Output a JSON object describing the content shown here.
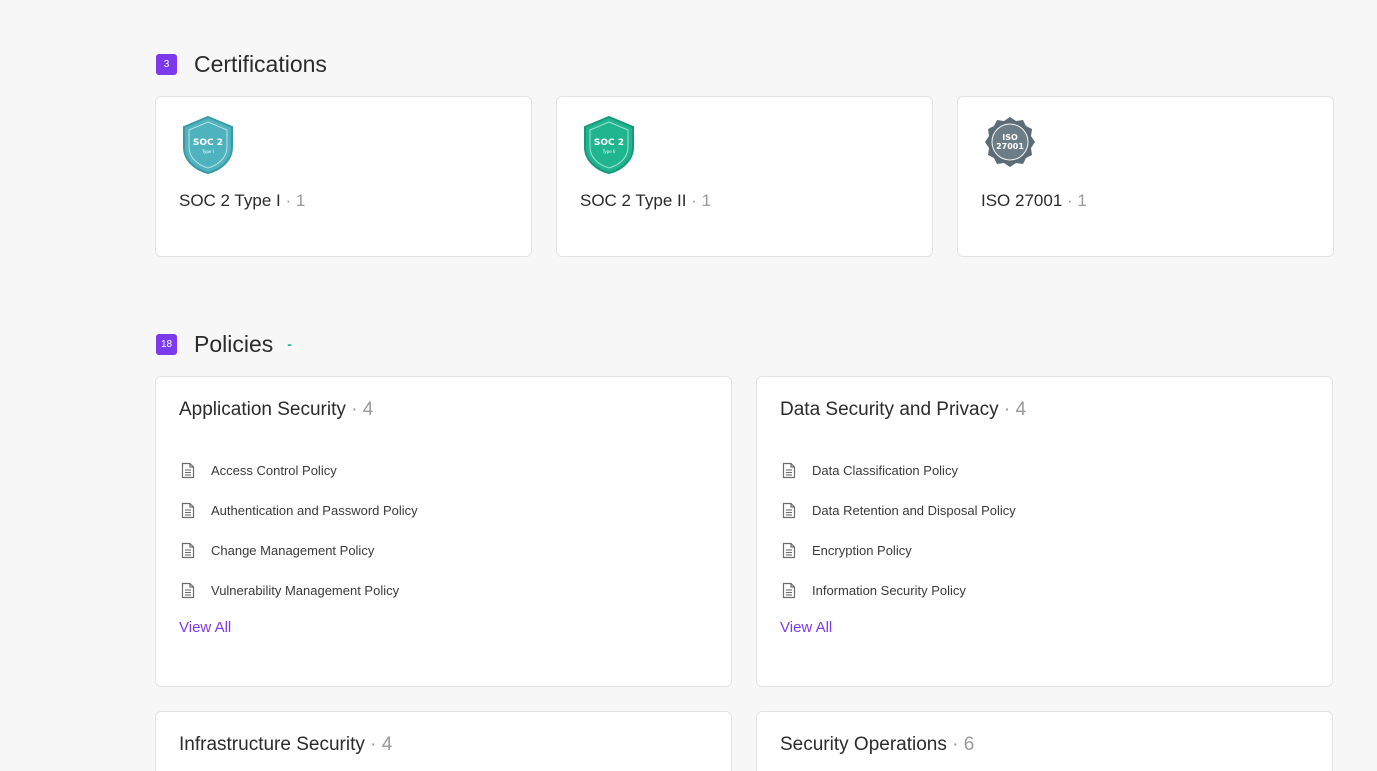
{
  "certifications": {
    "count": "3",
    "title": "Certifications",
    "items": [
      {
        "badge_top": "SOC 2",
        "badge_sub": "Type I",
        "name": "SOC 2 Type I",
        "sep": " · ",
        "count": "1",
        "color": "#4fb3bf"
      },
      {
        "badge_top": "SOC 2",
        "badge_sub": "Type II",
        "name": "SOC 2 Type II",
        "sep": " · ",
        "count": "1",
        "color": "#1fb58f"
      },
      {
        "badge_top": "ISO",
        "badge_sub": "27001",
        "name": "ISO 27001",
        "sep": " · ",
        "count": "1",
        "color": "#5c6c76"
      }
    ]
  },
  "policies": {
    "count": "18",
    "title": "Policies",
    "dash": "-",
    "groups": [
      {
        "title": "Application Security",
        "sep": " · ",
        "count": "4",
        "items": [
          "Access Control Policy",
          "Authentication and Password Policy",
          "Change Management Policy",
          "Vulnerability Management Policy"
        ],
        "view_all": "View All"
      },
      {
        "title": "Data Security and Privacy",
        "sep": " · ",
        "count": "4",
        "items": [
          "Data Classification Policy",
          "Data Retention and Disposal Policy",
          "Encryption Policy",
          "Information Security Policy"
        ],
        "view_all": "View All"
      },
      {
        "title": "Infrastructure Security",
        "sep": " · ",
        "count": "4"
      },
      {
        "title": "Security Operations",
        "sep": " · ",
        "count": "6"
      }
    ]
  },
  "colors": {
    "accent": "#7c3aed",
    "dash": "#1fb58f"
  },
  "icons": {
    "document": "document-icon"
  }
}
